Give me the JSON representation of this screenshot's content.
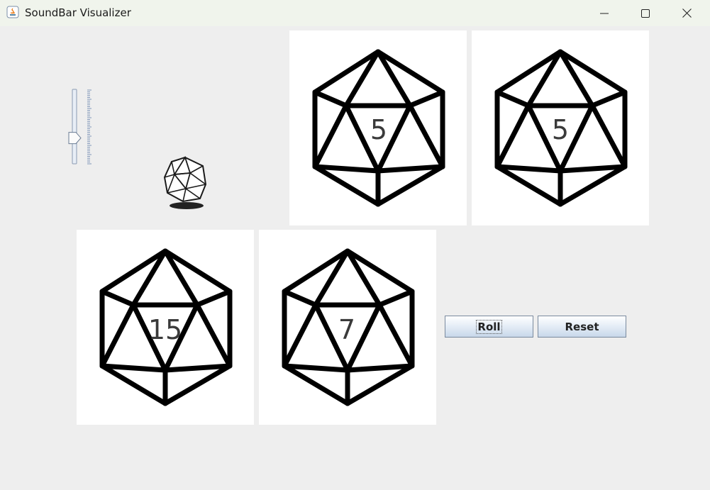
{
  "window": {
    "title": "SoundBar Visualizer",
    "controls": [
      "minimize",
      "maximize",
      "close"
    ]
  },
  "volume_slider": {
    "orientation": "vertical",
    "level": 0.35
  },
  "dice": [
    {
      "sides": 20,
      "value": "5"
    },
    {
      "sides": 20,
      "value": "5"
    },
    {
      "sides": 20,
      "value": "15"
    },
    {
      "sides": 20,
      "value": "7"
    }
  ],
  "buttons": {
    "roll_label": "Roll",
    "reset_label": "Reset"
  },
  "colors": {
    "button_border": "#7a8a9e",
    "titlebar": "#f0f4ec",
    "background": "#eeeeee"
  }
}
